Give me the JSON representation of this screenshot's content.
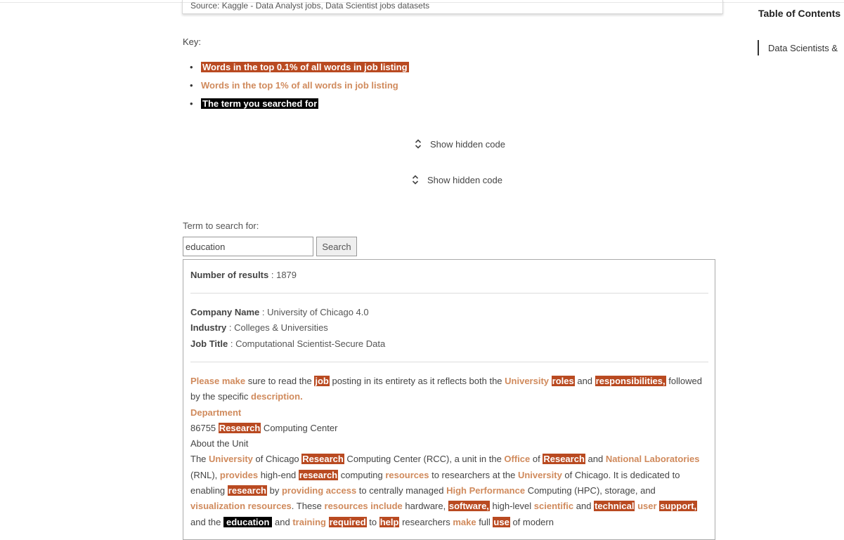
{
  "source_text": "Source: Kaggle - Data Analyst jobs, Data Scientist jobs datasets",
  "key": {
    "label": "Key:",
    "items": [
      "Words in the top 0.1% of all words in job listing",
      "Words in the top 1% of all words in job listing",
      "The term you searched for"
    ]
  },
  "toggles": [
    "Show hidden code",
    "Show hidden code"
  ],
  "search": {
    "label": "Term to search for:",
    "value": "education",
    "button": "Search"
  },
  "results": {
    "count_label": "Number of results",
    "count_value": "1879",
    "company_label": "Company Name",
    "company_value": "University of Chicago 4.0",
    "industry_label": "Industry",
    "industry_value": "Colleges & Universities",
    "job_title_label": "Job Title",
    "job_title_value": "Computational Scientist-Secure Data",
    "description": [
      [
        [
          "o",
          "Please make"
        ],
        [
          "t",
          " sure to read the "
        ],
        [
          "r",
          "job"
        ],
        [
          "t",
          " posting in its entirety as it reflects both the "
        ],
        [
          "o",
          "University"
        ],
        [
          "t",
          " "
        ],
        [
          "r",
          "roles"
        ],
        [
          "t",
          " and "
        ],
        [
          "r",
          "responsibilities,"
        ],
        [
          "t",
          " followed by the specific "
        ],
        [
          "o",
          "description."
        ]
      ],
      [
        [
          "o",
          "Department"
        ]
      ],
      [
        [
          "t",
          "86755 "
        ],
        [
          "r",
          "Research"
        ],
        [
          "t",
          " Computing Center"
        ]
      ],
      [
        [
          "t",
          "About the Unit"
        ]
      ],
      [
        [
          "t",
          "The "
        ],
        [
          "o",
          "University"
        ],
        [
          "t",
          " of Chicago "
        ],
        [
          "r",
          "Research"
        ],
        [
          "t",
          " Computing Center (RCC), a unit in the "
        ],
        [
          "o",
          "Office"
        ],
        [
          "t",
          " of "
        ],
        [
          "r",
          "Research"
        ],
        [
          "t",
          " and "
        ],
        [
          "o",
          "National Laboratories"
        ],
        [
          "t",
          " (RNL), "
        ],
        [
          "o",
          "provides"
        ],
        [
          "t",
          " high-end "
        ],
        [
          "r",
          "research"
        ],
        [
          "t",
          " computing "
        ],
        [
          "o",
          "resources"
        ],
        [
          "t",
          " to researchers at the "
        ],
        [
          "o",
          "University"
        ],
        [
          "t",
          " of Chicago. It is dedicated to enabling "
        ],
        [
          "r",
          "research"
        ],
        [
          "t",
          " by "
        ],
        [
          "o",
          "providing access"
        ],
        [
          "t",
          " to centrally managed "
        ],
        [
          "o",
          "High Performance"
        ],
        [
          "t",
          " Computing (HPC), storage, and "
        ],
        [
          "o",
          "visualization resources"
        ],
        [
          "t",
          ". These "
        ],
        [
          "o",
          "resources include"
        ],
        [
          "t",
          " hardware, "
        ],
        [
          "r",
          "software,"
        ],
        [
          "t",
          " high-level "
        ],
        [
          "o",
          "scientific"
        ],
        [
          "t",
          " and "
        ],
        [
          "r",
          "technical"
        ],
        [
          "t",
          " "
        ],
        [
          "o",
          "user"
        ],
        [
          "t",
          " "
        ],
        [
          "r",
          "support,"
        ],
        [
          "t",
          " and the "
        ],
        [
          "k",
          "education"
        ],
        [
          "t",
          " and "
        ],
        [
          "o",
          "training"
        ],
        [
          "t",
          " "
        ],
        [
          "r",
          "required"
        ],
        [
          "t",
          " to "
        ],
        [
          "r",
          "help"
        ],
        [
          "t",
          " researchers "
        ],
        [
          "o",
          "make"
        ],
        [
          "t",
          " full "
        ],
        [
          "r",
          "use"
        ],
        [
          "t",
          " of modern"
        ]
      ]
    ]
  },
  "toc": {
    "title": "Table of Contents",
    "items": [
      "Data Scientists &"
    ]
  }
}
